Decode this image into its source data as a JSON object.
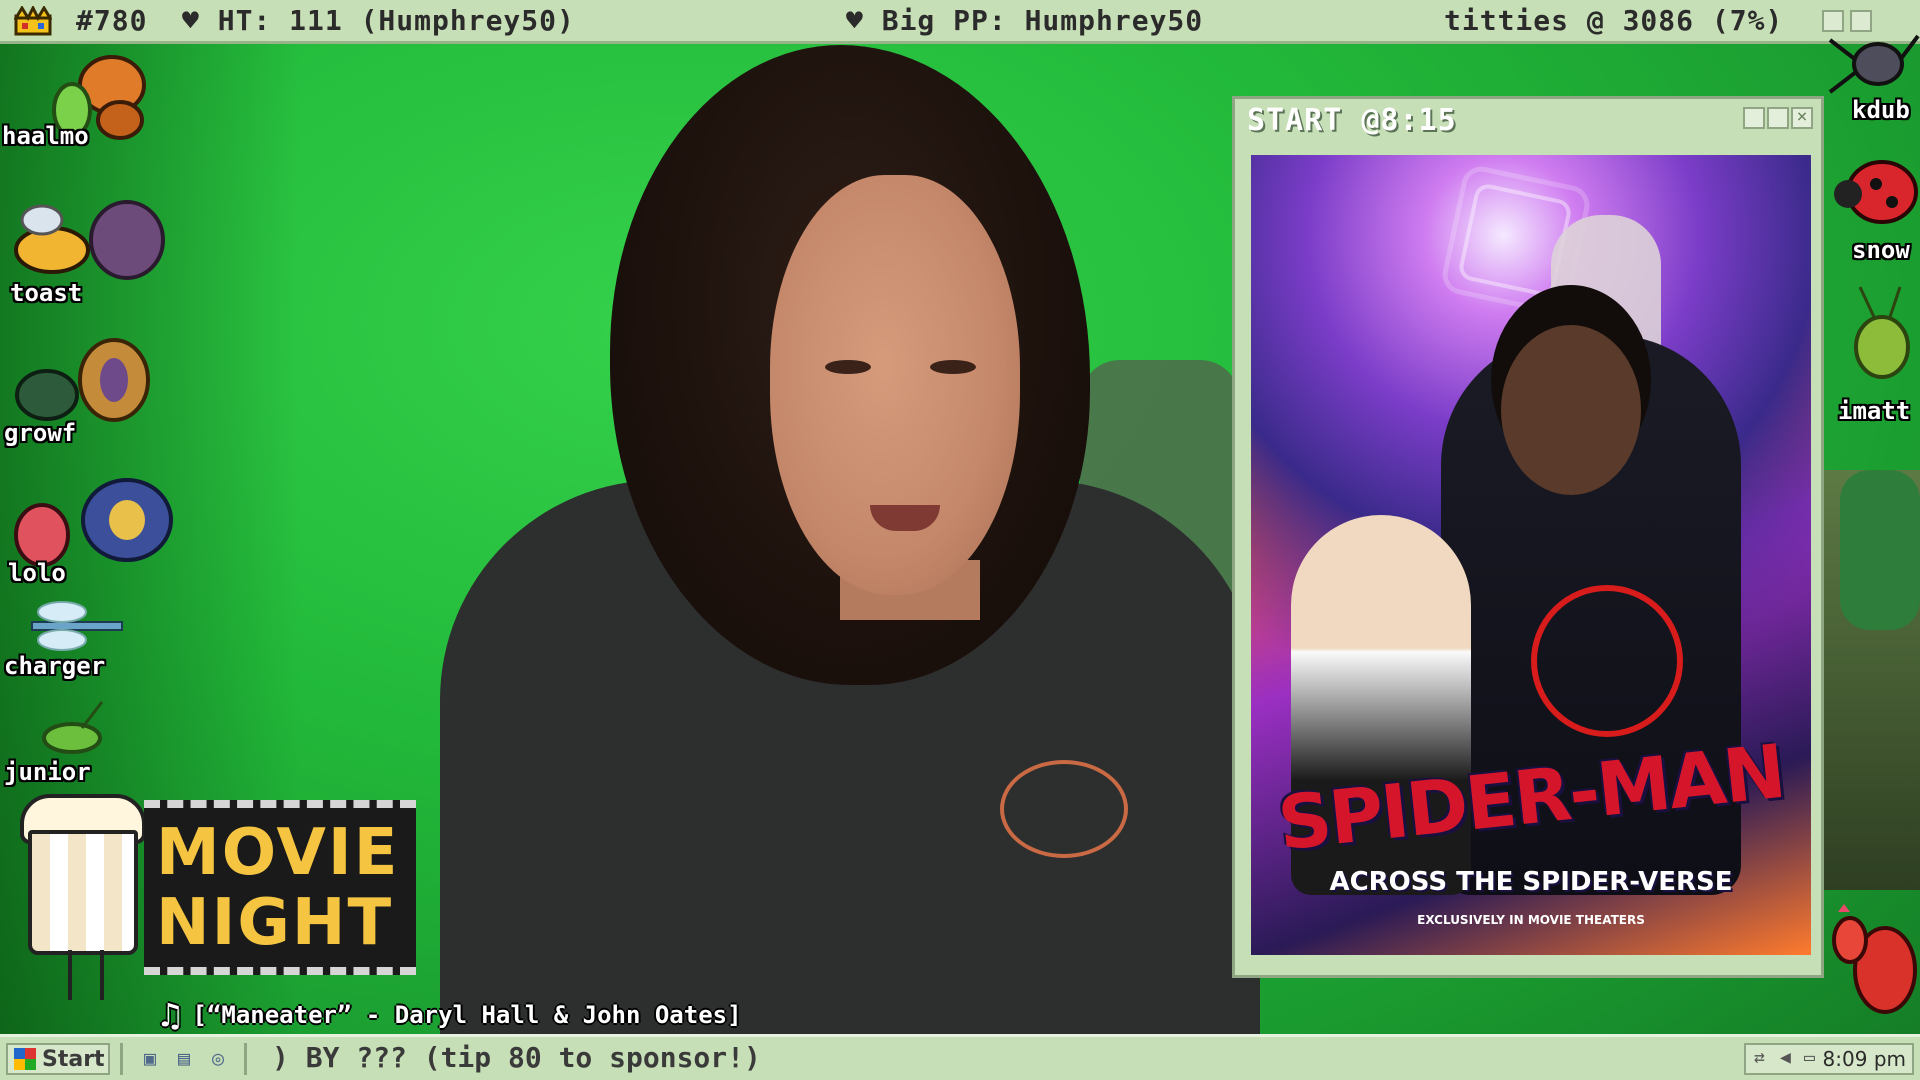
{
  "topbar": {
    "count": "#780",
    "ht": "♥ HT: 111 (Humphrey50)",
    "big_pp": "♥ Big PP: Humphrey50",
    "goal": "titties @ 3086 (7%)"
  },
  "bugs": {
    "left": [
      "haalmo",
      "toast",
      "growf",
      "lolo",
      "charger",
      "junior"
    ],
    "right": [
      "kdub",
      "snow",
      "imatt"
    ]
  },
  "window": {
    "title": "START @8:15",
    "poster": {
      "title": "SPIDER-MAN",
      "subtitle": "ACROSS THE SPIDER-VERSE",
      "tagline": "EXCLUSIVELY IN MOVIE THEATERS"
    }
  },
  "movie_night": {
    "line1": "MOVIE",
    "line2": "NIGHT"
  },
  "now_playing": {
    "icon": "music-note-icon",
    "text": "[“Maneater” - Daryl Hall & John Oates]"
  },
  "taskbar": {
    "start_label": "Start",
    "ticker": ") BY ??? (tip 80 to sponsor!)",
    "clock": "8:09 pm"
  },
  "colors": {
    "bar_bg": "#c7dfb6",
    "bar_border": "#8fa584",
    "greenscreen": "#22b93a",
    "title_text": "#ffffff"
  }
}
